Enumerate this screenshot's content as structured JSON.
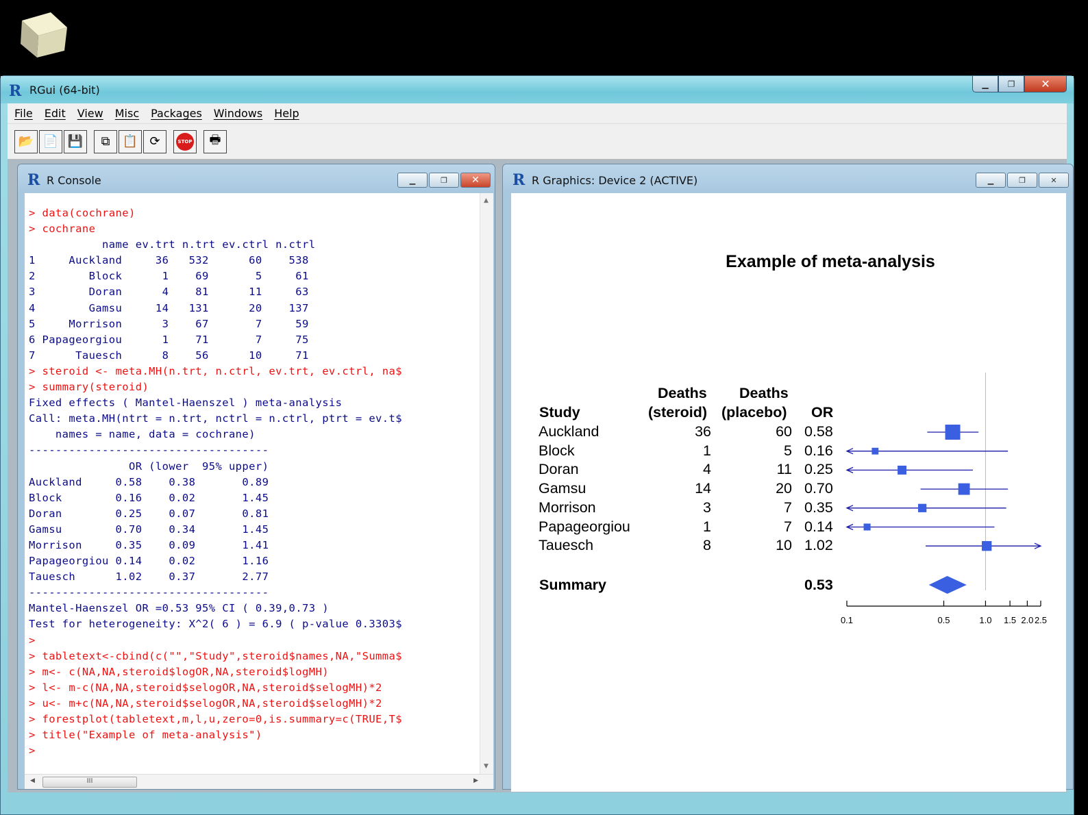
{
  "window": {
    "title": "RGui (64-bit)",
    "app_icon": "R-logo-icon"
  },
  "menubar": [
    "File",
    "Edit",
    "View",
    "Misc",
    "Packages",
    "Windows",
    "Help"
  ],
  "toolbar": [
    "open-script-icon",
    "load-workspace-icon",
    "save-workspace-icon",
    "copy-icon",
    "paste-icon",
    "copy-paste-icon",
    "stop-icon",
    "print-icon"
  ],
  "console": {
    "title": "R Console",
    "lines": [
      {
        "kind": "in",
        "text": "> data(cochrane)"
      },
      {
        "kind": "in",
        "text": "> cochrane"
      },
      {
        "kind": "out",
        "text": "           name ev.trt n.trt ev.ctrl n.ctrl"
      },
      {
        "kind": "out",
        "text": "1     Auckland     36   532      60    538"
      },
      {
        "kind": "out",
        "text": "2        Block      1    69       5     61"
      },
      {
        "kind": "out",
        "text": "3        Doran      4    81      11     63"
      },
      {
        "kind": "out",
        "text": "4        Gamsu     14   131      20    137"
      },
      {
        "kind": "out",
        "text": "5     Morrison      3    67       7     59"
      },
      {
        "kind": "out",
        "text": "6 Papageorgiou      1    71       7     75"
      },
      {
        "kind": "out",
        "text": "7      Tauesch      8    56      10     71"
      },
      {
        "kind": "in",
        "text": "> steroid <- meta.MH(n.trt, n.ctrl, ev.trt, ev.ctrl, na$"
      },
      {
        "kind": "in",
        "text": "> summary(steroid)"
      },
      {
        "kind": "out",
        "text": "Fixed effects ( Mantel-Haenszel ) meta-analysis"
      },
      {
        "kind": "out",
        "text": "Call: meta.MH(ntrt = n.trt, nctrl = n.ctrl, ptrt = ev.t$"
      },
      {
        "kind": "out",
        "text": "    names = name, data = cochrane)"
      },
      {
        "kind": "out",
        "text": "------------------------------------"
      },
      {
        "kind": "out",
        "text": "               OR (lower  95% upper)"
      },
      {
        "kind": "out",
        "text": "Auckland     0.58    0.38       0.89"
      },
      {
        "kind": "out",
        "text": "Block        0.16    0.02       1.45"
      },
      {
        "kind": "out",
        "text": "Doran        0.25    0.07       0.81"
      },
      {
        "kind": "out",
        "text": "Gamsu        0.70    0.34       1.45"
      },
      {
        "kind": "out",
        "text": "Morrison     0.35    0.09       1.41"
      },
      {
        "kind": "out",
        "text": "Papageorgiou 0.14    0.02       1.16"
      },
      {
        "kind": "out",
        "text": "Tauesch      1.02    0.37       2.77"
      },
      {
        "kind": "out",
        "text": "------------------------------------"
      },
      {
        "kind": "out",
        "text": "Mantel-Haenszel OR =0.53 95% CI ( 0.39,0.73 )"
      },
      {
        "kind": "out",
        "text": "Test for heterogeneity: X^2( 6 ) = 6.9 ( p-value 0.3303$"
      },
      {
        "kind": "in",
        "text": ">"
      },
      {
        "kind": "in",
        "text": "> tabletext<-cbind(c(\"\",\"Study\",steroid$names,NA,\"Summa$"
      },
      {
        "kind": "in",
        "text": "> m<- c(NA,NA,steroid$logOR,NA,steroid$logMH)"
      },
      {
        "kind": "in",
        "text": "> l<- m-c(NA,NA,steroid$selogOR,NA,steroid$selogMH)*2"
      },
      {
        "kind": "in",
        "text": "> u<- m+c(NA,NA,steroid$selogOR,NA,steroid$selogMH)*2"
      },
      {
        "kind": "in",
        "text": "> forestplot(tabletext,m,l,u,zero=0,is.summary=c(TRUE,T$"
      },
      {
        "kind": "in",
        "text": "> title(\"Example of meta-analysis\")"
      },
      {
        "kind": "in",
        "text": ">"
      }
    ],
    "scroll_thumb": "III"
  },
  "graphics": {
    "title": "R Graphics: Device 2 (ACTIVE)",
    "plot_title": "Example of meta-analysis",
    "header": {
      "study": "Study",
      "deaths1": "Deaths",
      "steroid": "(steroid)",
      "deaths2": "Deaths",
      "placebo": "(placebo)",
      "or": "OR"
    },
    "summary": {
      "label": "Summary",
      "or": "0.53"
    }
  },
  "chart_data": {
    "type": "forest",
    "x_scale": "log",
    "xticks": [
      "0.1",
      "0.5",
      "1.0",
      "1.5",
      "2.0",
      "2.5"
    ],
    "reference_line": 1.0,
    "columns": [
      "Study",
      "Deaths (steroid)",
      "Deaths (placebo)",
      "OR"
    ],
    "rows": [
      {
        "study": "Auckland",
        "steroid": "36",
        "placebo": "60",
        "or": "0.58",
        "est": 0.58,
        "lower": 0.38,
        "upper": 0.89
      },
      {
        "study": "Block",
        "steroid": "1",
        "placebo": "5",
        "or": "0.16",
        "est": 0.16,
        "lower": 0.02,
        "upper": 1.45
      },
      {
        "study": "Doran",
        "steroid": "4",
        "placebo": "11",
        "or": "0.25",
        "est": 0.25,
        "lower": 0.07,
        "upper": 0.81
      },
      {
        "study": "Gamsu",
        "steroid": "14",
        "placebo": "20",
        "or": "0.70",
        "est": 0.7,
        "lower": 0.34,
        "upper": 1.45
      },
      {
        "study": "Morrison",
        "steroid": "3",
        "placebo": "7",
        "or": "0.35",
        "est": 0.35,
        "lower": 0.09,
        "upper": 1.41
      },
      {
        "study": "Papageorgiou",
        "steroid": "1",
        "placebo": "7",
        "or": "0.14",
        "est": 0.14,
        "lower": 0.02,
        "upper": 1.16
      },
      {
        "study": "Tauesch",
        "steroid": "8",
        "placebo": "10",
        "or": "1.02",
        "est": 1.02,
        "lower": 0.37,
        "upper": 2.77
      }
    ],
    "summary": {
      "label": "Summary",
      "or": "0.53",
      "est": 0.53,
      "lower": 0.39,
      "upper": 0.73
    },
    "colors": {
      "marker": "#3a5fe0",
      "line": "#1a1aa8"
    }
  }
}
